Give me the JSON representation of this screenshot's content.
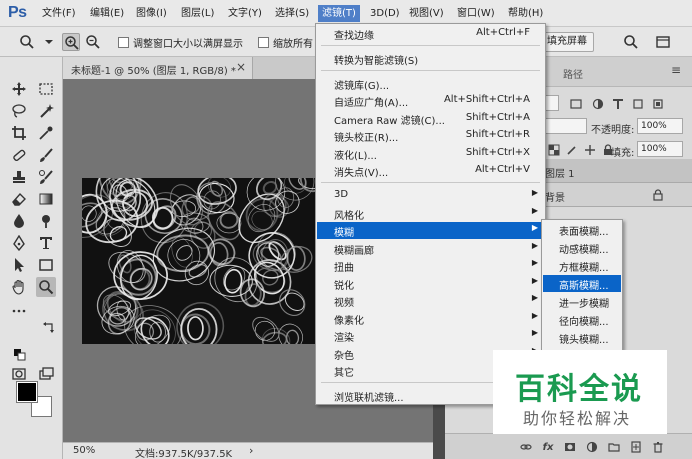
{
  "app": {
    "logo": "Ps"
  },
  "menubar": {
    "items": [
      "文件(F)",
      "编辑(E)",
      "图像(I)",
      "图层(L)",
      "文字(Y)",
      "选择(S)",
      "滤镜(T)",
      "3D(D)",
      "视图(V)",
      "窗口(W)",
      "帮助(H)"
    ],
    "active_index": 6
  },
  "options": {
    "resize_windows_label": "调整窗口大小以满屏显示",
    "zoom_all_label": "缩放所有",
    "fill_screen_label": "填充屏幕"
  },
  "document": {
    "tab_title": "未标题-1 @ 50% (图层 1, RGB/8) *",
    "close_glyph": "×",
    "zoom": "50%",
    "doc_size": "文档:937.5K/937.5K"
  },
  "panels": {
    "tab_paths": "路径",
    "opacity_label": "不透明度:",
    "opacity_value": "100%",
    "fill_label": "填充:",
    "fill_value": "100%",
    "layers": [
      {
        "name": "图层 1"
      },
      {
        "name": "背景"
      }
    ]
  },
  "filter_menu": {
    "items": [
      {
        "label": "查找边缘",
        "shortcut": "Alt+Ctrl+F"
      },
      {
        "label": "转换为智能滤镜(S)",
        "shortcut": ""
      },
      {
        "label": "滤镜库(G)...",
        "shortcut": ""
      },
      {
        "label": "自适应广角(A)...",
        "shortcut": "Alt+Shift+Ctrl+A"
      },
      {
        "label": "Camera Raw 滤镜(C)...",
        "shortcut": "Shift+Ctrl+A"
      },
      {
        "label": "镜头校正(R)...",
        "shortcut": "Shift+Ctrl+R"
      },
      {
        "label": "液化(L)...",
        "shortcut": "Shift+Ctrl+X"
      },
      {
        "label": "消失点(V)...",
        "shortcut": "Alt+Ctrl+V"
      },
      {
        "label": "3D",
        "shortcut": ""
      },
      {
        "label": "风格化",
        "shortcut": ""
      },
      {
        "label": "模糊",
        "shortcut": ""
      },
      {
        "label": "模糊画廊",
        "shortcut": ""
      },
      {
        "label": "扭曲",
        "shortcut": ""
      },
      {
        "label": "锐化",
        "shortcut": ""
      },
      {
        "label": "视频",
        "shortcut": ""
      },
      {
        "label": "像素化",
        "shortcut": ""
      },
      {
        "label": "渲染",
        "shortcut": ""
      },
      {
        "label": "杂色",
        "shortcut": ""
      },
      {
        "label": "其它",
        "shortcut": ""
      },
      {
        "label": "浏览联机滤镜...",
        "shortcut": ""
      }
    ],
    "highlighted": "模糊"
  },
  "blur_submenu": {
    "items": [
      "表面模糊...",
      "动感模糊...",
      "方框模糊...",
      "高斯模糊...",
      "进一步模糊",
      "径向模糊...",
      "镜头模糊...",
      "模糊"
    ],
    "highlighted": "高斯模糊..."
  },
  "watermark": {
    "title": "百科全说",
    "subtitle": "助你轻松解决"
  },
  "colors": {
    "menu_highlight": "#0a64c8",
    "watermark_green": "#1a9a50",
    "ps_blue": "#2d5ea8"
  }
}
